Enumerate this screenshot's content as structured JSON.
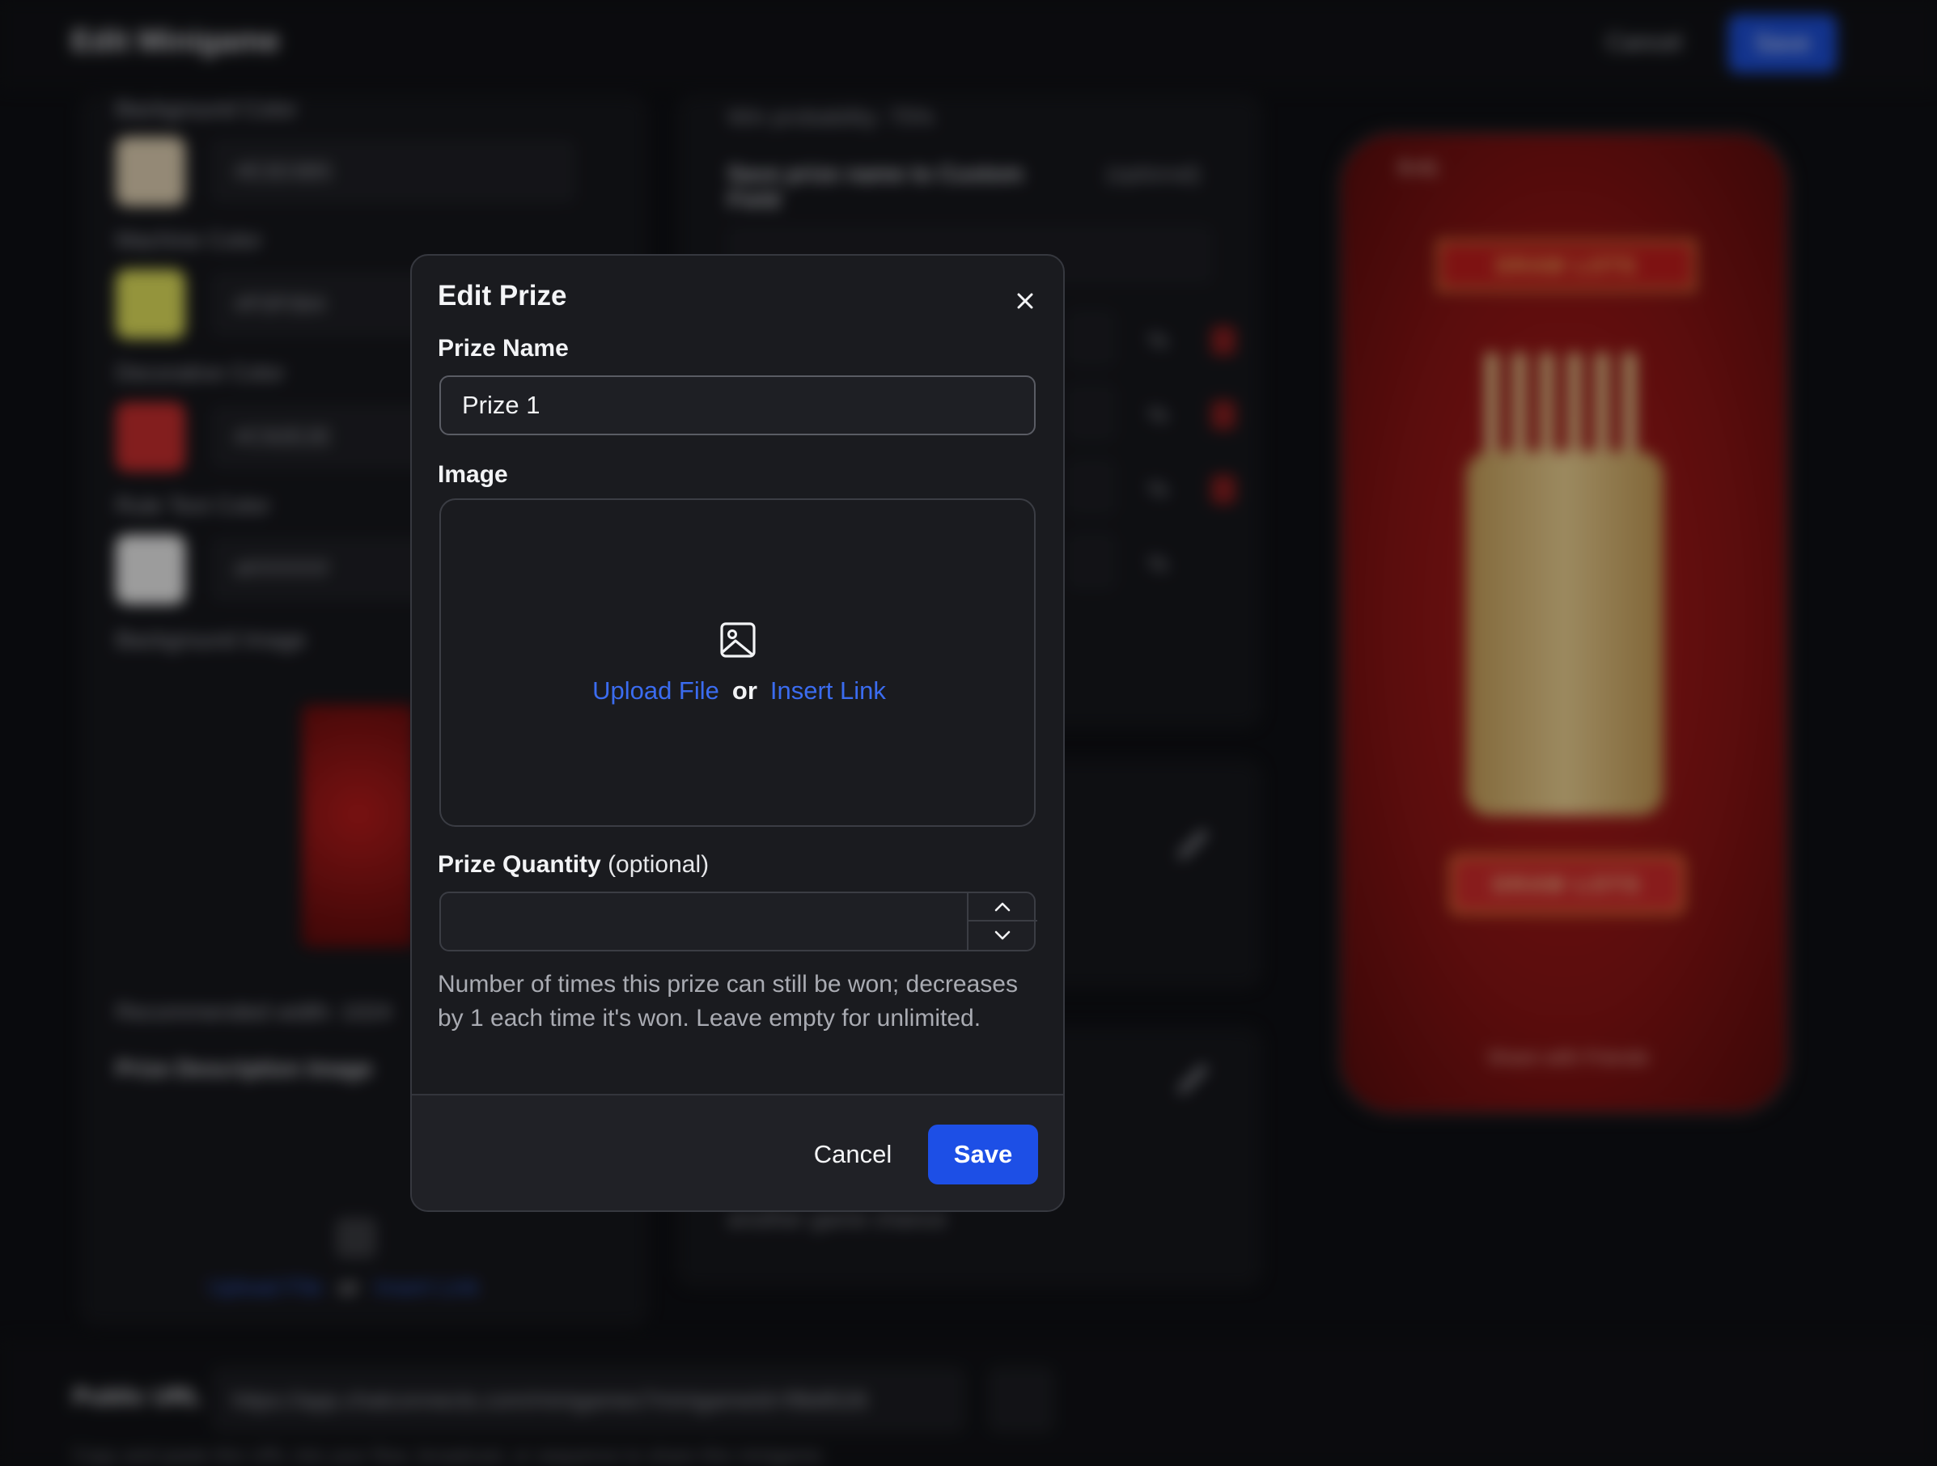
{
  "background": {
    "header": {
      "title": "Edit Minigame",
      "cancel_label": "Cancel",
      "save_label": "Save"
    },
    "settings": {
      "colors": [
        {
          "label": "Background Color",
          "hex": "#E3D3B5"
        },
        {
          "label": "Machine Color",
          "hex": "#F0F064"
        },
        {
          "label": "Decorative Color",
          "hex": "#C92E2E"
        },
        {
          "label": "Rule Text Color",
          "hex": "#FFFFFF"
        }
      ],
      "background_image_label": "Background Image",
      "recommended_width": "Recommended width: 1024",
      "prize_description_label": "Prize Description Image",
      "upload_label": "Upload File",
      "or_label": "or",
      "insert_link_label": "Insert Link"
    },
    "prizes": {
      "win_probability": "Win probability: 75%",
      "save_prize_label": "Save prize name to Custom Field",
      "optional_label": "(optional)",
      "percent": "%",
      "mid_text_1": "another game chance"
    },
    "phone": {
      "time": "9:41",
      "banner": "DRAW LOTS",
      "button": "DRAW LOTS",
      "share": "Share with Friends"
    },
    "footer": {
      "label": "Public URL",
      "url": "https://app.chatconnects.com/minigames?minigameId=f9b8526",
      "hint": "Copy and paste this URL into your flow, broadcast, or sequence to share this minigame."
    }
  },
  "modal": {
    "title": "Edit Prize",
    "prize_name_label": "Prize Name",
    "prize_name_value": "Prize 1",
    "image_label": "Image",
    "upload_file_label": "Upload File",
    "or_label": "or",
    "insert_link_label": "Insert Link",
    "quantity_label": "Prize Quantity",
    "quantity_optional": "(optional)",
    "quantity_value": "",
    "help_text": "Number of times this prize can still be won; decreases by 1 each time it's won. Leave empty for unlimited.",
    "cancel_label": "Cancel",
    "save_label": "Save",
    "accent_color": "#1D4FE6"
  }
}
